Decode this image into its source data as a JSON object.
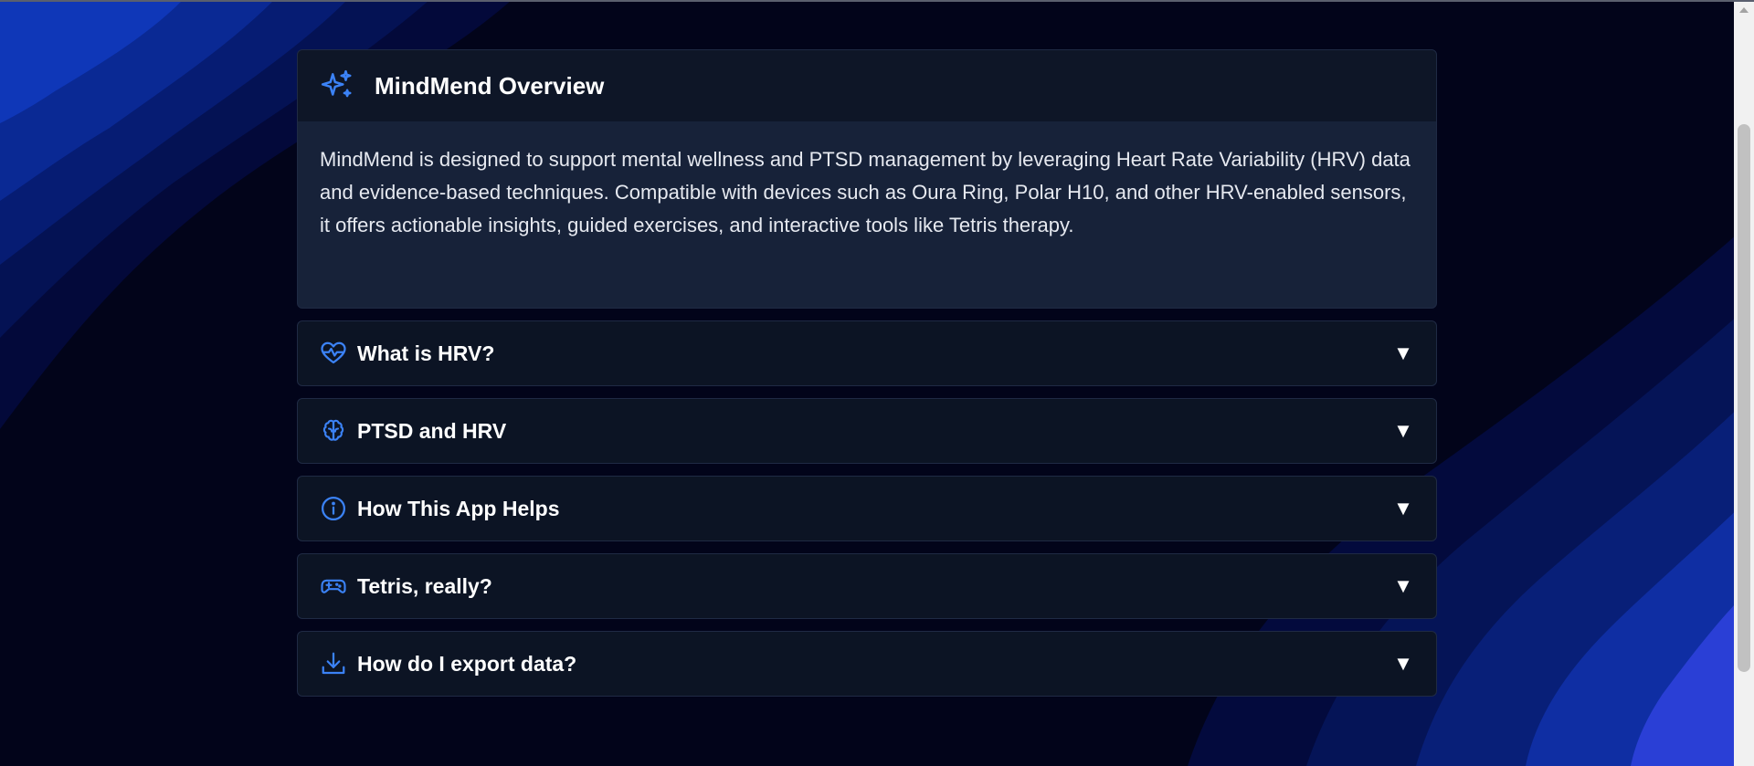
{
  "overview": {
    "title": "MindMend Overview",
    "icon": "sparkles-icon",
    "description": "MindMend is designed to support mental wellness and PTSD management by leveraging Heart Rate Variability (HRV) data and evidence-based techniques. Compatible with devices such as Oura Ring, Polar H10, and other HRV-enabled sensors, it offers actionable insights, guided exercises, and interactive tools like Tetris therapy."
  },
  "accordion": [
    {
      "label": "What is HRV?",
      "icon": "heart-pulse-icon",
      "caret": "▼"
    },
    {
      "label": "PTSD and HRV",
      "icon": "brain-icon",
      "caret": "▼"
    },
    {
      "label": "How This App Helps",
      "icon": "info-icon",
      "caret": "▼"
    },
    {
      "label": "Tetris, really?",
      "icon": "gamepad-icon",
      "caret": "▼"
    },
    {
      "label": "How do I export data?",
      "icon": "download-icon",
      "caret": "▼"
    }
  ],
  "colors": {
    "accent": "#3b82f6",
    "background": "#02041a",
    "card_header": "#0e1627",
    "card_body": "#172239",
    "accordion_bg": "#0c1424"
  }
}
